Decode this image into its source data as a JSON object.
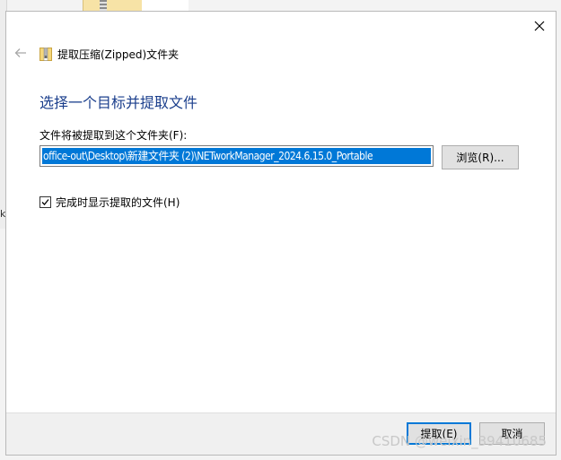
{
  "dialog": {
    "title": "提取压缩(Zipped)文件夹",
    "heading": "选择一个目标并提取文件",
    "path_label": "文件将被提取到这个文件夹(F):",
    "path_value": "office-out\\Desktop\\新建文件夹 (2)\\NETworkManager_2024.6.15.0_Portable",
    "browse_label": "浏览(R)...",
    "checkbox_label": "完成时显示提取的文件(H)",
    "checkbox_checked": true,
    "extract_label": "提取(E)",
    "cancel_label": "取消"
  },
  "background": {
    "left_glyph": "k"
  },
  "watermark": "CSDN @weixin_39410685",
  "colors": {
    "accent": "#0078d7",
    "heading": "#1a3e8c",
    "footer_bg": "#f0f0f0"
  },
  "icons": {
    "close": "close-icon",
    "back": "back-arrow-icon",
    "zip_folder": "zip-folder-icon",
    "checkmark": "checkmark-icon"
  }
}
